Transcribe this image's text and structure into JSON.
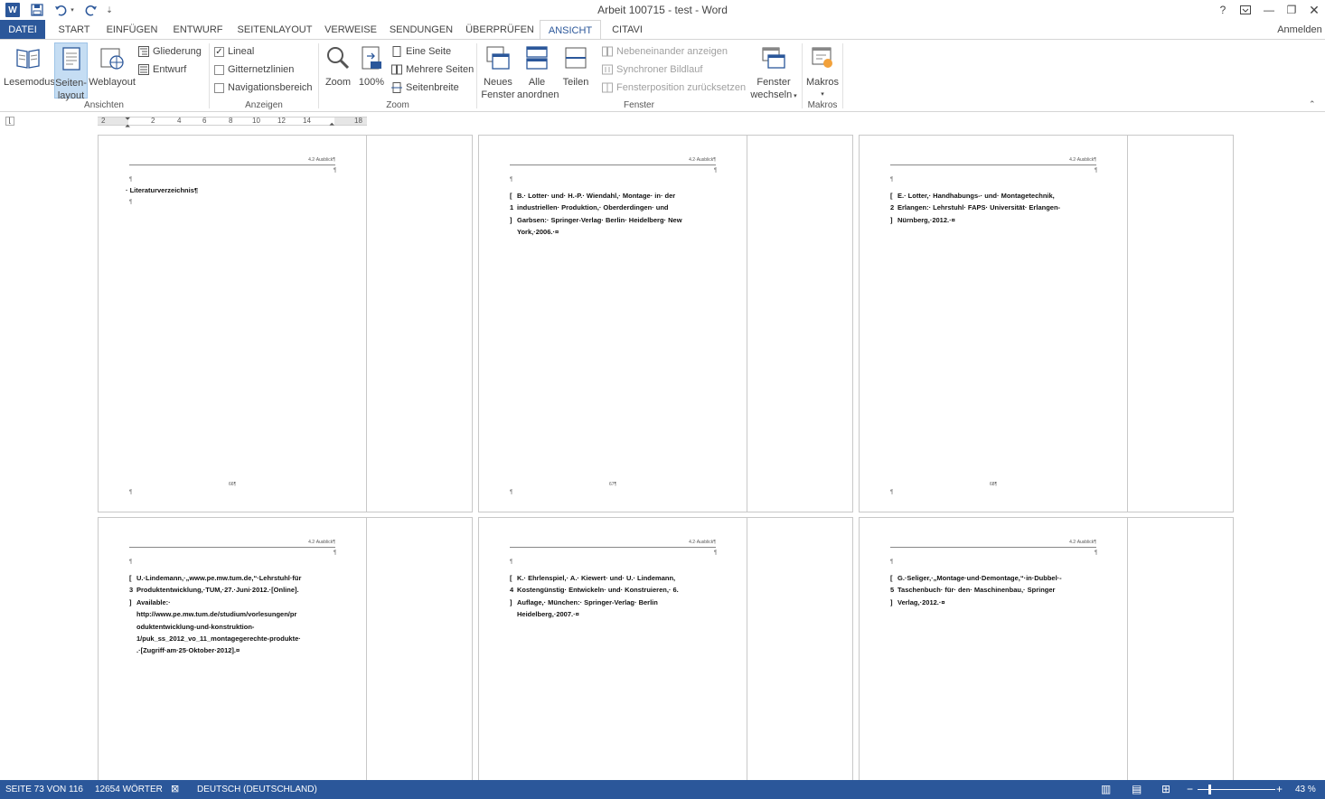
{
  "window": {
    "title": "Arbeit 100715 - test - Word",
    "help": "?",
    "signin": "Anmelden"
  },
  "tabs": [
    {
      "label": "DATEI"
    },
    {
      "label": "START"
    },
    {
      "label": "EINFÜGEN"
    },
    {
      "label": "ENTWURF"
    },
    {
      "label": "SEITENLAYOUT"
    },
    {
      "label": "VERWEISE"
    },
    {
      "label": "SENDUNGEN"
    },
    {
      "label": "ÜBERPRÜFEN"
    },
    {
      "label": "ANSICHT"
    },
    {
      "label": "CITAVI"
    }
  ],
  "active_tab": "ANSICHT",
  "ribbon": {
    "ansichten": {
      "label": "Ansichten",
      "lesemodus": "Lesemodus",
      "seitenlayout_1": "Seiten-",
      "seitenlayout_2": "layout",
      "weblayout": "Weblayout",
      "gliederung": "Gliederung",
      "entwurf": "Entwurf"
    },
    "anzeigen": {
      "label": "Anzeigen",
      "lineal": "Lineal",
      "lineal_checked": true,
      "gitternetz": "Gitternetzlinien",
      "gitternetz_checked": false,
      "navigation": "Navigationsbereich",
      "navigation_checked": false
    },
    "zoom": {
      "label": "Zoom",
      "zoom": "Zoom",
      "hundred": "100%",
      "eine_seite": "Eine Seite",
      "mehrere_seiten": "Mehrere Seiten",
      "seitenbreite": "Seitenbreite"
    },
    "fenster": {
      "label": "Fenster",
      "neues_1": "Neues",
      "neues_2": "Fenster",
      "alle_1": "Alle",
      "alle_2": "anordnen",
      "teilen": "Teilen",
      "nebeneinander": "Nebeneinander anzeigen",
      "synchron": "Synchroner Bildlauf",
      "fensterposition": "Fensterposition zurücksetzen",
      "wechseln_1": "Fenster",
      "wechseln_2": "wechseln"
    },
    "makros": {
      "label": "Makros",
      "makros": "Makros"
    }
  },
  "ruler": {
    "ticks": [
      "2",
      "2",
      "4",
      "6",
      "8",
      "10",
      "12",
      "14",
      "18"
    ]
  },
  "pages": [
    {
      "header": "4.2·Ausblick¶",
      "pilcrow": "¶",
      "heading": "Literaturverzeichnis¶",
      "num": "66¶",
      "ref_num": "",
      "lines": []
    },
    {
      "header": "4.2·Ausblick¶",
      "pilcrow": "¶",
      "heading": "",
      "num": "67¶",
      "ref_num": [
        "[",
        "1",
        "]"
      ],
      "lines": [
        "B.· Lotter· und· H.-P.· Wiendahl,· Montage· in· der",
        "industriellen·    Produktion,·    Oberderdingen·    und",
        "Garbsen:· Springer-Verlag· Berlin· Heidelberg· New",
        "York,·2006.·¤"
      ]
    },
    {
      "header": "4.2·Ausblick¶",
      "pilcrow": "¶",
      "heading": "",
      "num": "68¶",
      "ref_num": [
        "[",
        "2",
        "]"
      ],
      "lines": [
        "E.·  Lotter,·  Handhabungs-·  und·  Montagetechnik,",
        "Erlangen:·  Lehrstuhl·  FAPS·  Universität·  Erlangen-",
        "Nürnberg,·2012.·¤"
      ]
    },
    {
      "header": "4.2·Ausblick¶",
      "pilcrow": "¶",
      "heading": "",
      "num": "",
      "ref_num": [
        "[",
        "3",
        "]"
      ],
      "lines": [
        "U.·Lindemann,·„www.pe.mw.tum.de,“·Lehrstuhl·für",
        "Produktentwicklung,·TUM,·27.·Juni·2012.·[Online].",
        "Available:·",
        "http://www.pe.mw.tum.de/studium/vorlesungen/pr",
        "oduktentwicklung-und-konstruktion-",
        "1/puk_ss_2012_vo_11_montagegerechte-produkte·",
        ".·[Zugriff·am·25·Oktober·2012].¤"
      ]
    },
    {
      "header": "4.2·Ausblick¶",
      "pilcrow": "¶",
      "heading": "",
      "num": "",
      "ref_num": [
        "[",
        "4",
        "]"
      ],
      "lines": [
        "K.·  Ehrlenspiel,·  A.·  Kiewert·  und·  U.·  Lindemann,",
        "Kostengünstig·  Entwickeln·  und·  Konstruieren,·  6.",
        "Auflage,·    München:·    Springer-Verlag·    Berlin",
        "Heidelberg,·2007.·¤"
      ]
    },
    {
      "header": "4.2·Ausblick¶",
      "pilcrow": "¶",
      "heading": "",
      "num": "",
      "ref_num": [
        "[",
        "5",
        "]"
      ],
      "lines": [
        "G.·Seliger,·„Montage·und·Demontage,“·in·Dubbel·-",
        "Taschenbuch·  für·  den·  Maschinenbau,·  Springer",
        "Verlag,·2012.·¤"
      ]
    }
  ],
  "status": {
    "page": "SEITE 73 VON 116",
    "words": "12654 WÖRTER",
    "language": "DEUTSCH (DEUTSCHLAND)",
    "zoom": "43 %"
  },
  "colors": {
    "accent": "#2b579a",
    "selected": "#c5ddf3"
  }
}
